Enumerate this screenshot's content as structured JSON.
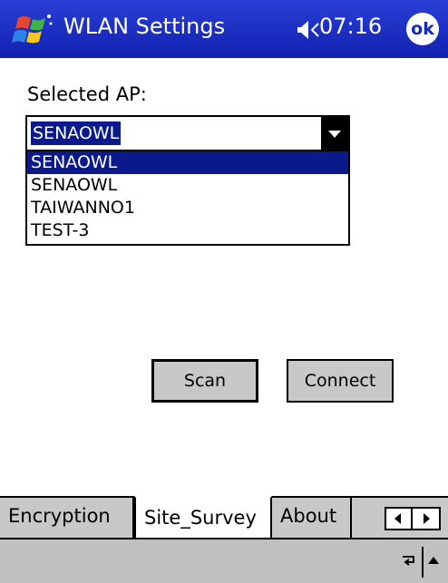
{
  "titlebar": {
    "title": "WLAN Settings",
    "time": "07:16",
    "ok_label": "ok",
    "start_icon": "windows-flag-icon",
    "speaker_icon": "speaker-icon",
    "background": "#1428b8"
  },
  "form": {
    "selected_ap_label": "Selected AP:",
    "selected_value": "SENAOWL",
    "options": [
      "SENAOWL",
      "SENAOWL",
      "TAIWANNO1",
      "TEST-3"
    ],
    "highlight_color": "#0a1a8c"
  },
  "buttons": {
    "scan": "Scan",
    "connect": "Connect"
  },
  "tabs": [
    {
      "label": "Encryption",
      "active": false
    },
    {
      "label": "Site_Survey",
      "active": true
    },
    {
      "label": "About",
      "active": false
    }
  ],
  "menubar": {
    "input_icon": "input-method-icon",
    "sip_icon": "sip-up-arrow-icon"
  }
}
